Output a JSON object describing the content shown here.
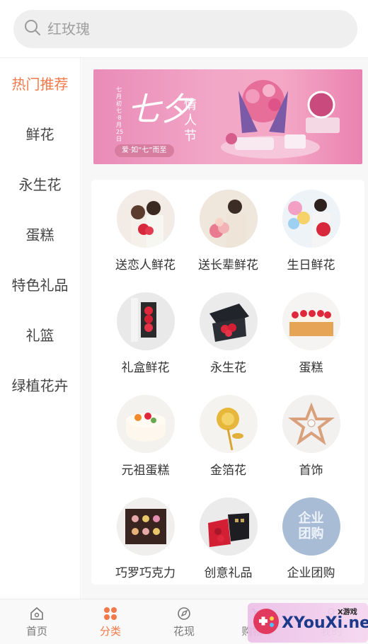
{
  "search": {
    "placeholder": "红玫瑰",
    "icon": "search-icon"
  },
  "sidebar": {
    "active_color": "#f27a4a",
    "items": [
      {
        "label": "热门推荐",
        "active": true
      },
      {
        "label": "鲜花"
      },
      {
        "label": "永生花"
      },
      {
        "label": "蛋糕"
      },
      {
        "label": "特色礼品"
      },
      {
        "label": "礼篮"
      },
      {
        "label": "绿植花卉"
      }
    ]
  },
  "banner": {
    "title": "七夕",
    "festival": "情人节",
    "date": "七月初七·8月25日",
    "tagline": "爱·如“七”而至"
  },
  "grid": {
    "items": [
      {
        "label": "送恋人鲜花",
        "icon": "couple-flowers-image"
      },
      {
        "label": "送长辈鲜花",
        "icon": "elder-flowers-image"
      },
      {
        "label": "生日鲜花",
        "icon": "birthday-flowers-image"
      },
      {
        "label": "礼盒鲜花",
        "icon": "gift-box-flowers-image"
      },
      {
        "label": "永生花",
        "icon": "preserved-flower-image"
      },
      {
        "label": "蛋糕",
        "icon": "cake-image"
      },
      {
        "label": "元祖蛋糕",
        "icon": "fruit-cake-image"
      },
      {
        "label": "金箔花",
        "icon": "gold-rose-image"
      },
      {
        "label": "首饰",
        "icon": "star-pendant-image"
      },
      {
        "label": "巧罗巧克力",
        "icon": "chocolate-image"
      },
      {
        "label": "创意礼品",
        "icon": "creative-gift-image"
      },
      {
        "label": "企业团购",
        "icon": "enterprise-group-image"
      }
    ],
    "enterprise_badge_text": "企业团购"
  },
  "tabbar": {
    "items": [
      {
        "label": "首页",
        "icon": "home-icon"
      },
      {
        "label": "分类",
        "icon": "category-icon",
        "active": true
      },
      {
        "label": "花现",
        "icon": "discover-icon"
      },
      {
        "label": "购物车",
        "icon": "cart-icon"
      },
      {
        "label": "我的",
        "icon": "user-icon"
      }
    ]
  },
  "watermark": {
    "text": "XYouXi.net",
    "small": "X游戏"
  }
}
